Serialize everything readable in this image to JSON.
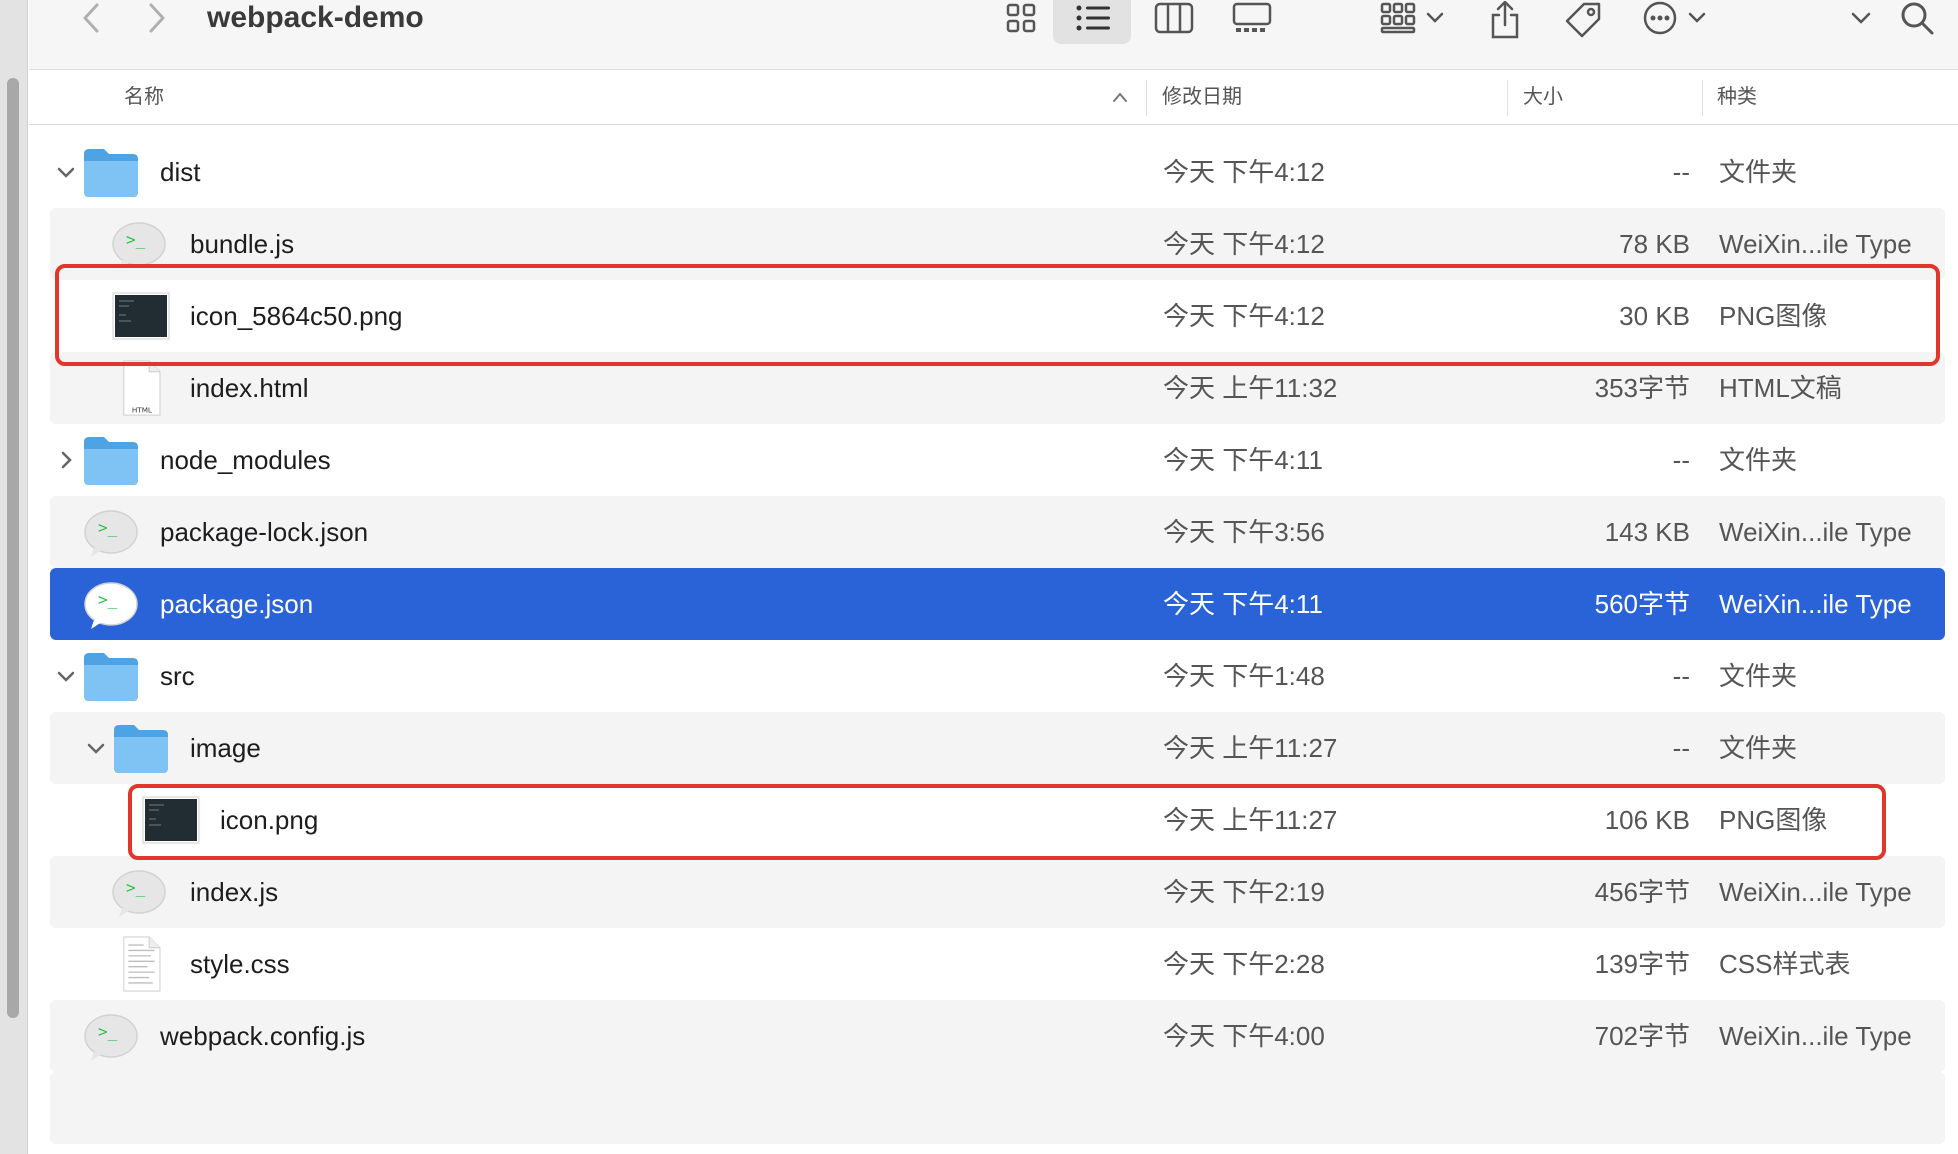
{
  "window": {
    "title": "webpack-demo"
  },
  "columns": {
    "name": "名称",
    "date": "修改日期",
    "size": "大小",
    "kind": "种类"
  },
  "rows": [
    {
      "name": "dist",
      "date": "今天 下午4:12",
      "size": "--",
      "kind": "文件夹"
    },
    {
      "name": "bundle.js",
      "date": "今天 下午4:12",
      "size": "78 KB",
      "kind": "WeiXin...ile Type"
    },
    {
      "name": "icon_5864c50.png",
      "date": "今天 下午4:12",
      "size": "30 KB",
      "kind": "PNG图像"
    },
    {
      "name": "index.html",
      "date": "今天 上午11:32",
      "size": "353字节",
      "kind": "HTML文稿",
      "icon_label": "HTML"
    },
    {
      "name": "node_modules",
      "date": "今天 下午4:11",
      "size": "--",
      "kind": "文件夹"
    },
    {
      "name": "package-lock.json",
      "date": "今天 下午3:56",
      "size": "143 KB",
      "kind": "WeiXin...ile Type"
    },
    {
      "name": "package.json",
      "date": "今天 下午4:11",
      "size": "560字节",
      "kind": "WeiXin...ile Type"
    },
    {
      "name": "src",
      "date": "今天 下午1:48",
      "size": "--",
      "kind": "文件夹"
    },
    {
      "name": "image",
      "date": "今天 上午11:27",
      "size": "--",
      "kind": "文件夹"
    },
    {
      "name": "icon.png",
      "date": "今天 上午11:27",
      "size": "106 KB",
      "kind": "PNG图像"
    },
    {
      "name": "index.js",
      "date": "今天 下午2:19",
      "size": "456字节",
      "kind": "WeiXin...ile Type"
    },
    {
      "name": "style.css",
      "date": "今天 下午2:28",
      "size": "139字节",
      "kind": "CSS样式表"
    },
    {
      "name": "webpack.config.js",
      "date": "今天 下午4:00",
      "size": "702字节",
      "kind": "WeiXin...ile Type"
    }
  ],
  "colors": {
    "selection": "#2a63d8",
    "annotation": "#e0362c",
    "folder": "#5aaee8"
  }
}
